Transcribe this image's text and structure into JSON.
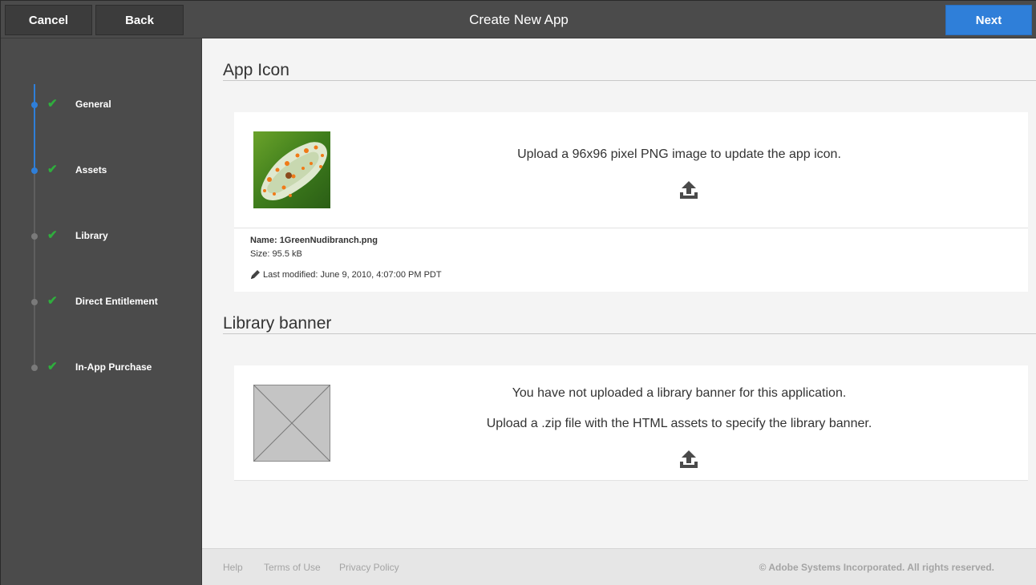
{
  "header": {
    "cancel_label": "Cancel",
    "back_label": "Back",
    "title": "Create New App",
    "next_label": "Next"
  },
  "sidebar": {
    "steps": [
      {
        "label": "General",
        "status": "complete"
      },
      {
        "label": "Assets",
        "status": "current"
      },
      {
        "label": "Library",
        "status": "complete"
      },
      {
        "label": "Direct Entitlement",
        "status": "complete"
      },
      {
        "label": "In-App Purchase",
        "status": "complete"
      }
    ]
  },
  "app_icon": {
    "title": "App Icon",
    "message": "Upload a 96x96 pixel PNG image to update the app icon.",
    "name_label": "Name:",
    "name_value": "1GreenNudibranch.png",
    "size_label": "Size:",
    "size_value": "95.5 kB",
    "modified_text": "Last modified: June 9, 2010, 4:07:00 PM PDT"
  },
  "library_banner": {
    "title": "Library banner",
    "message_1": "You have not uploaded a library banner for this application.",
    "message_2": "Upload a .zip file with the HTML assets to specify the library banner."
  },
  "footer": {
    "links": [
      "Help",
      "Terms of Use",
      "Privacy Policy"
    ],
    "copyright": "© Adobe Systems Incorporated. All rights reserved."
  },
  "colors": {
    "accent": "#2f7fd9",
    "check": "#2fae3d",
    "sidebar_bg": "#4b4b4b",
    "main_bg": "#f4f4f4"
  }
}
